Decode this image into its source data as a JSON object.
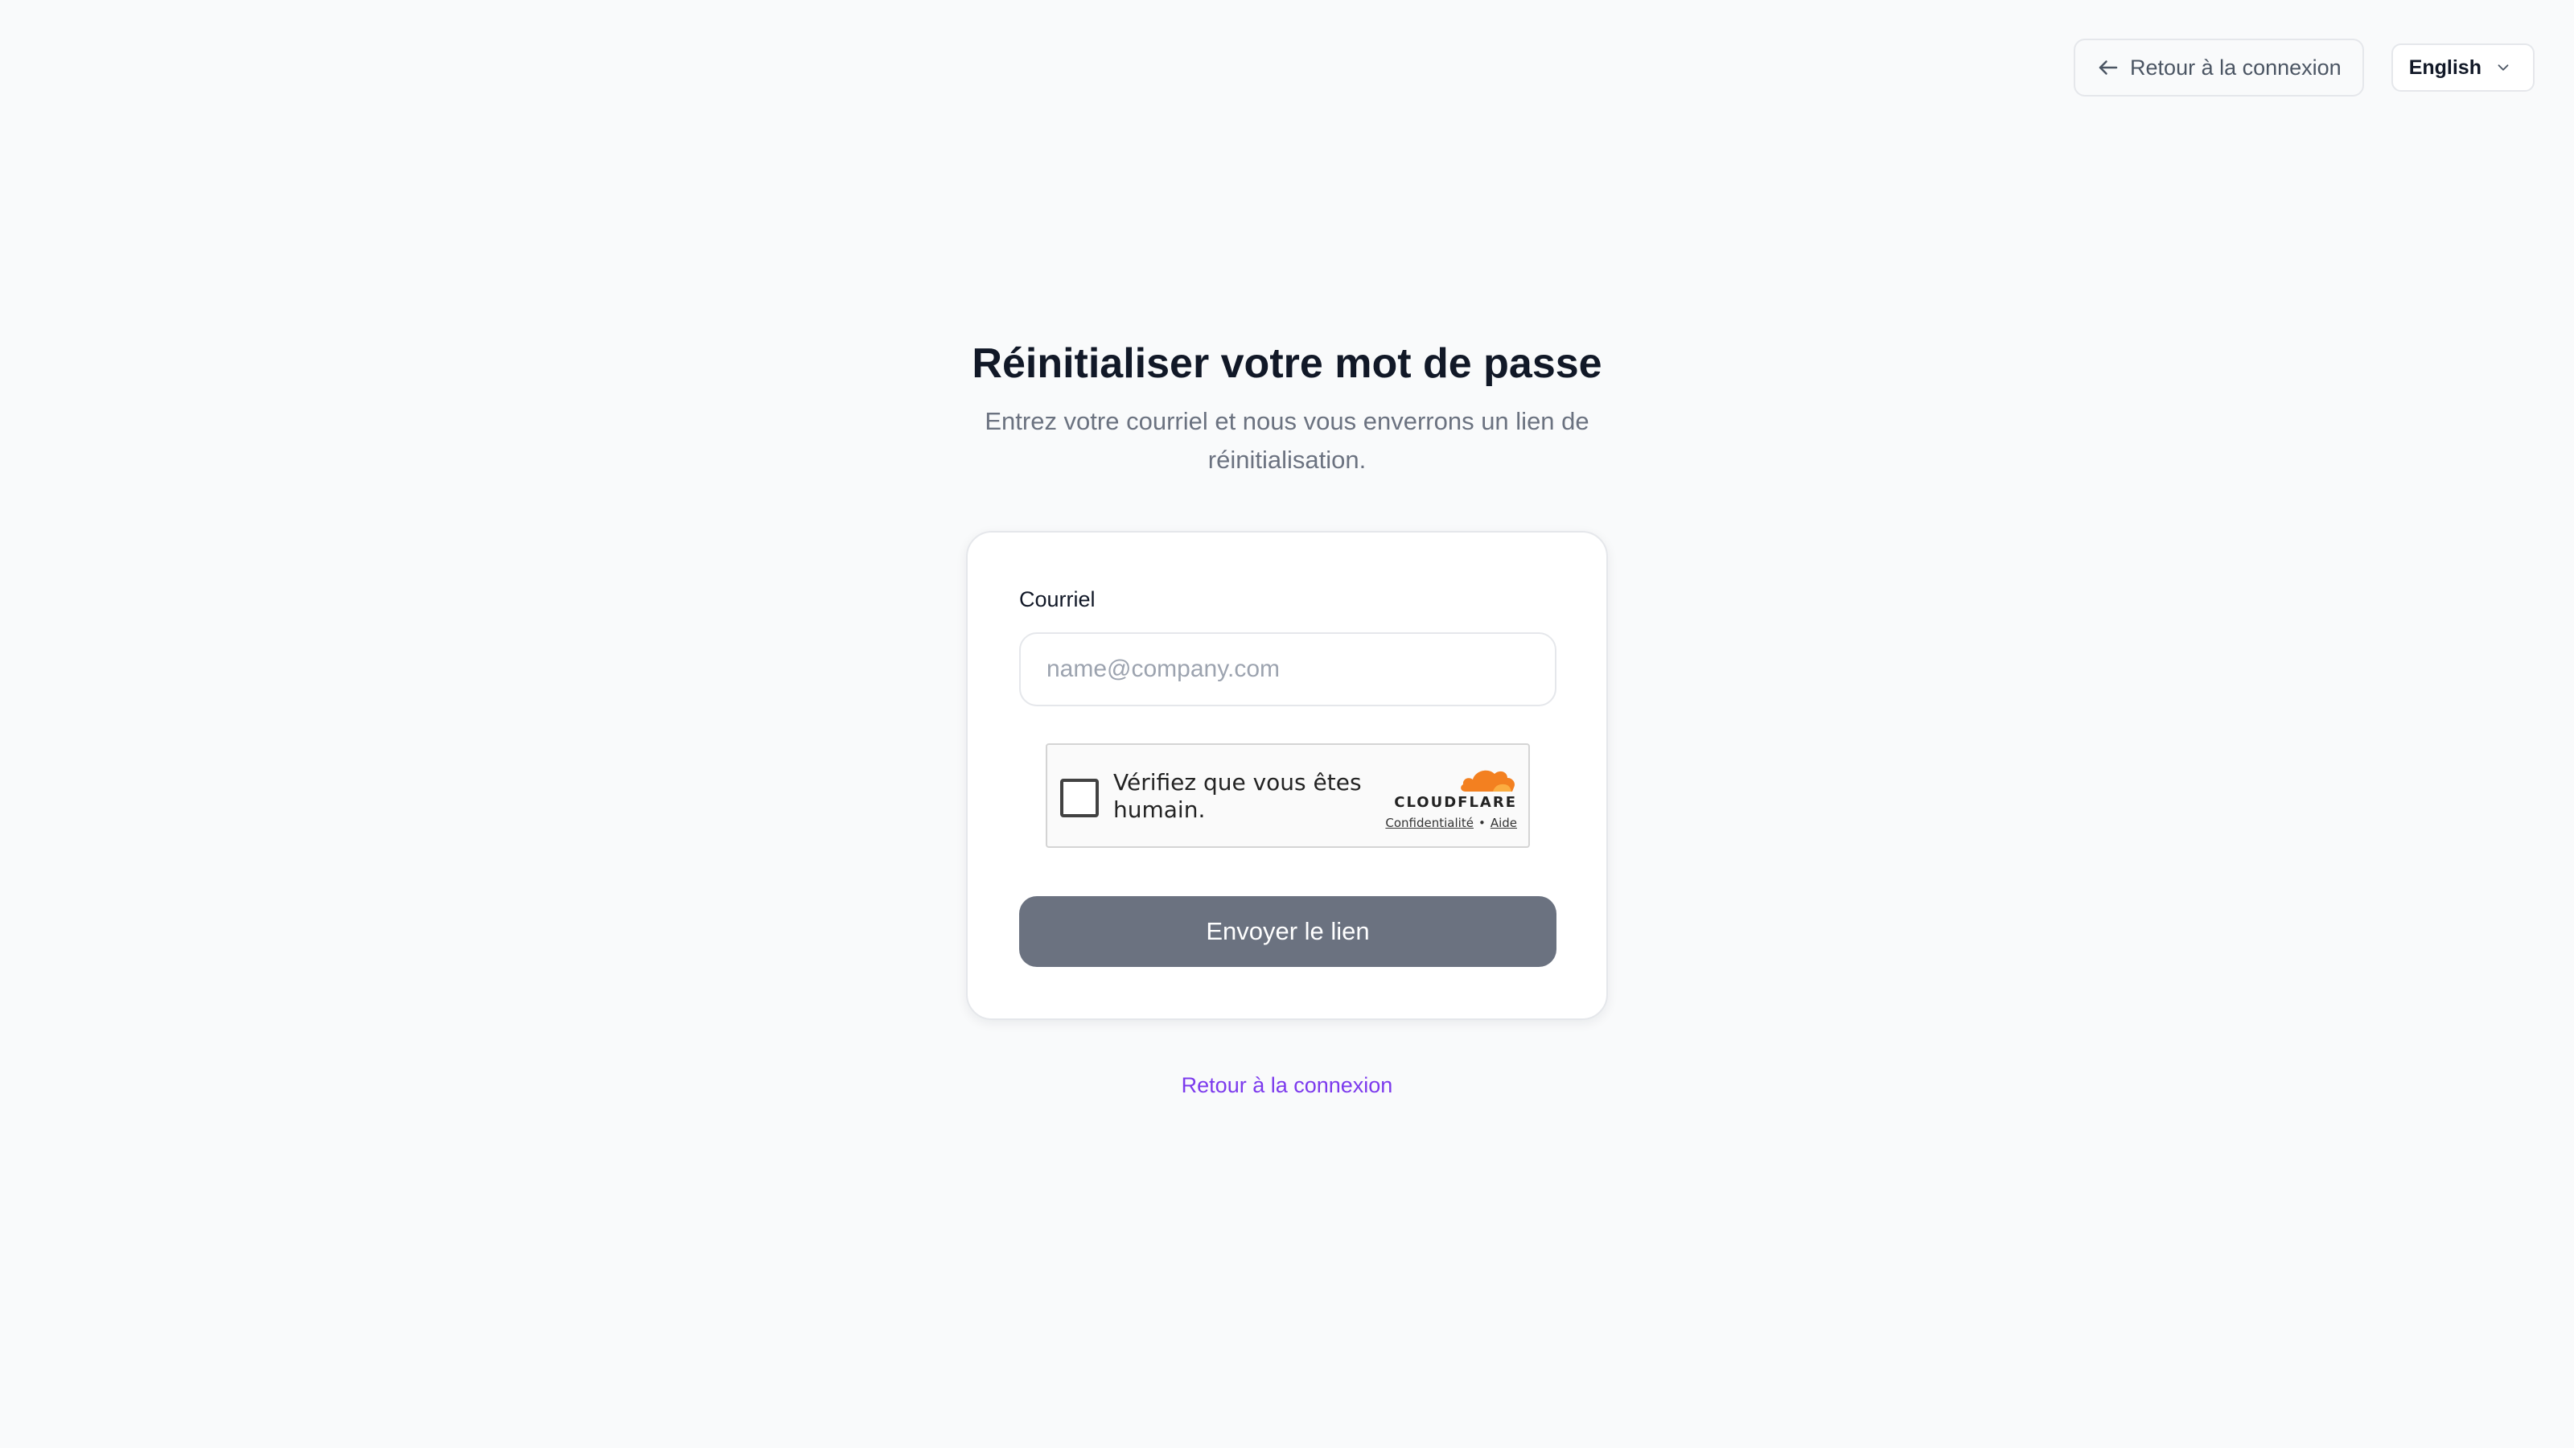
{
  "header": {
    "back_label": "Retour à la connexion",
    "back_icon": "arrow-left-icon",
    "language": {
      "selected": "English",
      "icon": "chevron-down-icon"
    }
  },
  "main": {
    "title": "Réinitialiser votre mot de passe",
    "subtitle": "Entrez votre courriel et nous vous enverrons un lien de réinitialisation."
  },
  "form": {
    "email_label": "Courriel",
    "email_value": "",
    "email_placeholder": "name@company.com",
    "submit_label": "Envoyer le lien"
  },
  "captcha": {
    "text": "Vérifiez que vous êtes humain.",
    "brand": "CLOUDFLARE",
    "privacy_label": "Confidentialité",
    "separator": "•",
    "help_label": "Aide",
    "logo_icon": "cloudflare-cloud-icon"
  },
  "footer": {
    "back_link_label": "Retour à la connexion"
  },
  "colors": {
    "background": "#f9fafb",
    "accent_link": "#7c3aed",
    "button_disabled": "#6b7280",
    "cloudflare_orange": "#f38020"
  }
}
